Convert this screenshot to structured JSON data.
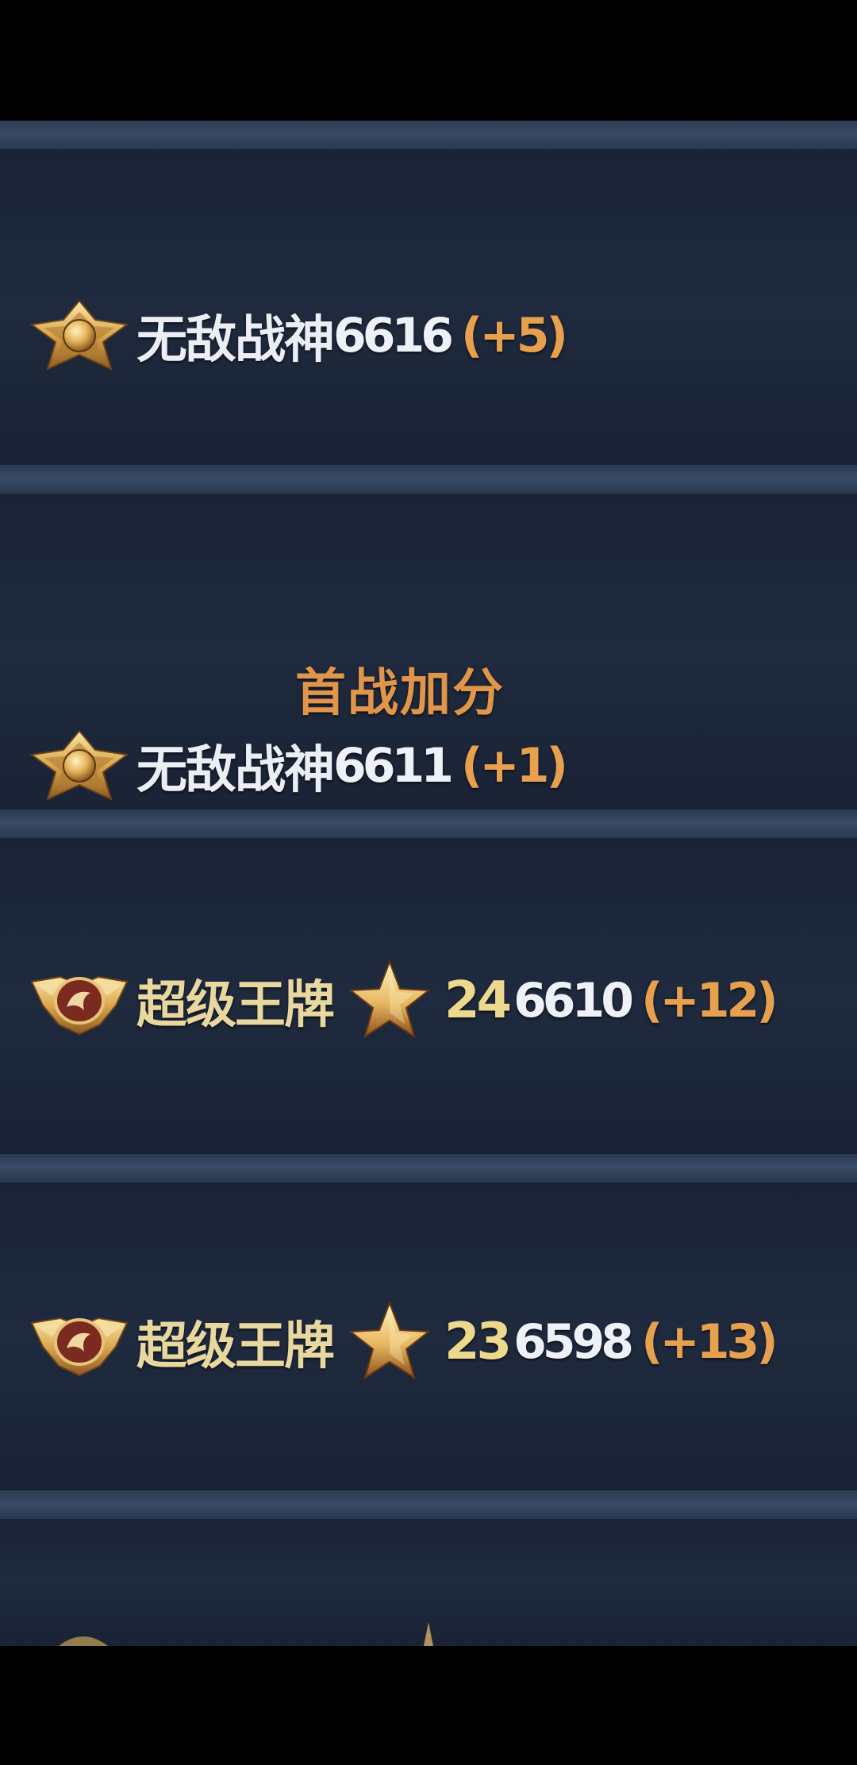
{
  "colors": {
    "background": "#1c2638",
    "divider": "#34445e",
    "score_text": "#eef1f7",
    "delta_text": "#e7a14e",
    "star_count_text": "#ecd98e",
    "bonus_label_text": "#e0954a"
  },
  "records": [
    {
      "badge_icon": "invincible-god-badge-icon",
      "tier": "无敌战神",
      "score": "6616",
      "delta": "(+5)"
    },
    {
      "label": "首战加分",
      "badge_icon": "invincible-god-badge-icon",
      "tier": "无敌战神",
      "score": "6611",
      "delta": "(+1)"
    },
    {
      "badge_icon": "super-ace-badge-icon",
      "tier": "超级王牌",
      "star_icon": "star-icon",
      "stars": "24",
      "score": "6610",
      "delta": "(+12)"
    },
    {
      "badge_icon": "super-ace-badge-icon",
      "tier": "超级王牌",
      "star_icon": "star-icon",
      "stars": "23",
      "score": "6598",
      "delta": "(+13)"
    }
  ]
}
